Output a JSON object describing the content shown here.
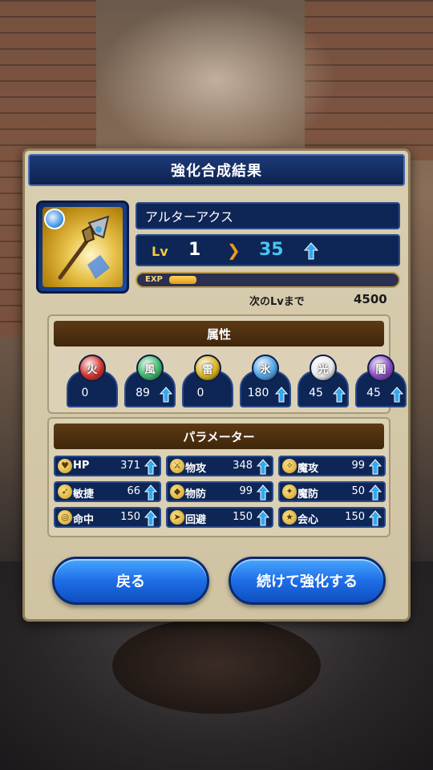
{
  "dialog": {
    "title": "強化合成結果"
  },
  "item": {
    "name": "アルターアクス",
    "lv_label": "Lv",
    "lv_from": "1",
    "lv_to": "35",
    "exp_label": "EXP",
    "exp_fill_fraction": 0.12,
    "next_lv_label": "次のLvまで",
    "next_lv_value": "4500",
    "element_badge_icon": "ice-crystal-icon"
  },
  "attributes": {
    "title": "属性",
    "items": [
      {
        "name": "火",
        "value": "0",
        "up": false,
        "color": "#d8302a"
      },
      {
        "name": "風",
        "value": "89",
        "up": true,
        "color": "#3bb86a"
      },
      {
        "name": "雷",
        "value": "0",
        "up": false,
        "color": "#d9b21e"
      },
      {
        "name": "氷",
        "value": "180",
        "up": true,
        "color": "#4aa3e6"
      },
      {
        "name": "光",
        "value": "45",
        "up": true,
        "color": "#e8e8ea"
      },
      {
        "name": "闇",
        "value": "45",
        "up": true,
        "color": "#8a4ac8"
      }
    ]
  },
  "parameters": {
    "title": "パラメーター",
    "items": [
      {
        "name": "HP",
        "value": "371",
        "icon": "heart-icon"
      },
      {
        "name": "物攻",
        "value": "348",
        "icon": "sword-icon"
      },
      {
        "name": "魔攻",
        "value": "99",
        "icon": "staff-icon"
      },
      {
        "name": "敏捷",
        "value": "66",
        "icon": "wing-icon"
      },
      {
        "name": "物防",
        "value": "99",
        "icon": "shield-icon"
      },
      {
        "name": "魔防",
        "value": "50",
        "icon": "magic-shield-icon"
      },
      {
        "name": "命中",
        "value": "150",
        "icon": "target-icon"
      },
      {
        "name": "回避",
        "value": "150",
        "icon": "dodge-icon"
      },
      {
        "name": "会心",
        "value": "150",
        "icon": "crit-icon"
      }
    ]
  },
  "buttons": {
    "back": "戻る",
    "continue": "続けて強化する"
  },
  "colors": {
    "up_arrow": "#33a8f0"
  }
}
